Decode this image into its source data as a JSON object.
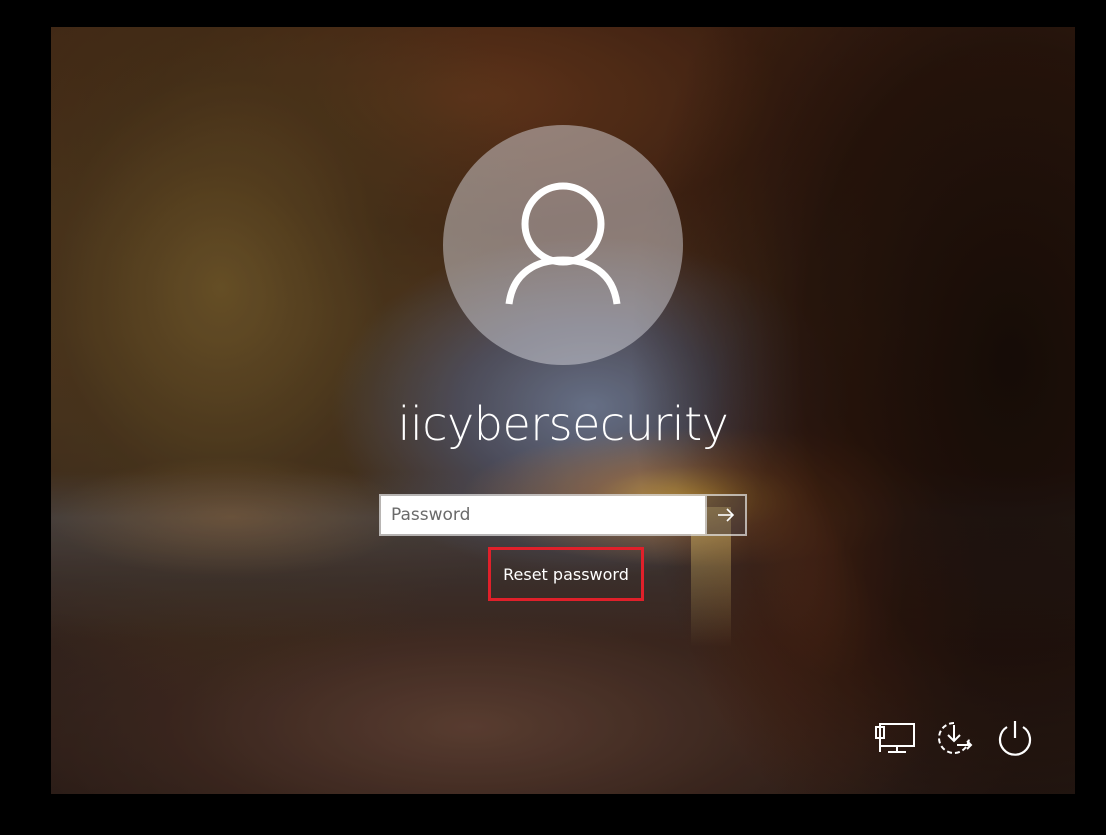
{
  "lock_screen": {
    "username": "iicybersecurity",
    "password": {
      "placeholder": "Password",
      "value": ""
    },
    "submit_icon": "arrow-right-icon",
    "reset_password_label": "Reset password",
    "highlight_color": "#e0202a"
  },
  "corner_controls": [
    {
      "icon": "network-icon"
    },
    {
      "icon": "ease-of-access-icon"
    },
    {
      "icon": "power-icon"
    }
  ]
}
